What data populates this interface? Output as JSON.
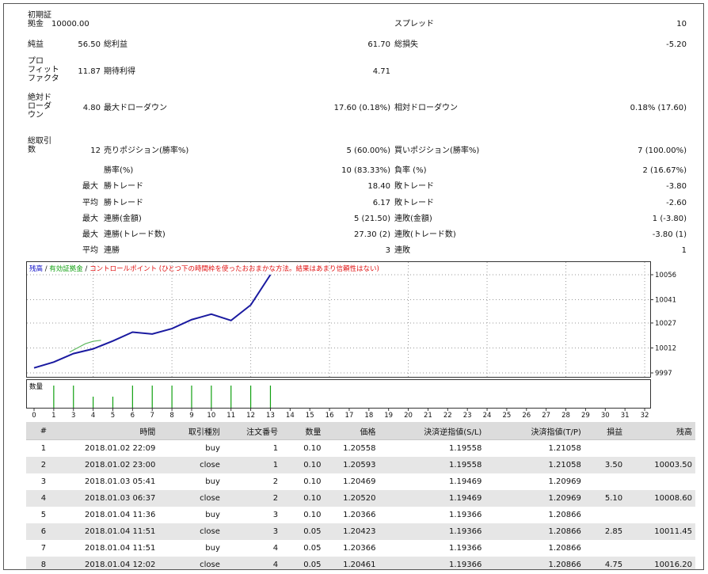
{
  "summary": {
    "initial_deposit_label": "初期証\n拠金",
    "initial_deposit": "10000.00",
    "spread_label": "スプレッド",
    "spread": "10",
    "net_profit_label": "純益",
    "net_profit": "56.50",
    "gross_profit_label": "総利益",
    "gross_profit": "61.70",
    "gross_loss_label": "総損失",
    "gross_loss": "-5.20",
    "profit_factor_label": "プロ\nフィット\nファクタ",
    "profit_factor": "11.87",
    "expected_payoff_label": "期待利得",
    "expected_payoff": "4.71",
    "abs_drawdown_label": "絶対ド\nローダ\nウン",
    "abs_drawdown": "4.80",
    "max_drawdown_label": "最大ドローダウン",
    "max_drawdown": "17.60 (0.18%)",
    "rel_drawdown_label": "相対ドローダウン",
    "rel_drawdown": "0.18% (17.60)",
    "total_trades_label": "総取引\n数",
    "total_trades": "12",
    "short_label": "売りポジション(勝率%)",
    "short_value": "5 (60.00%)",
    "long_label": "買いポジション(勝率%)",
    "long_value": "7 (100.00%)",
    "win_rate_label": "勝率(%)",
    "win_rate": "10 (83.33%)",
    "loss_rate_label": "負率 (%)",
    "loss_rate": "2 (16.67%)",
    "max_prefix": "最大",
    "avg_prefix": "平均",
    "largest_win_label": "勝トレード",
    "largest_win": "18.40",
    "largest_loss_label": "敗トレード",
    "largest_loss": "-3.80",
    "avg_win_label": "勝トレード",
    "avg_win": "6.17",
    "avg_loss_label": "敗トレード",
    "avg_loss": "-2.60",
    "max_consec_wins_label": "連勝(金額)",
    "max_consec_wins": "5 (21.50)",
    "max_consec_losses_label": "連敗(金額)",
    "max_consec_losses": "1 (-3.80)",
    "max_consec_profit_label": "連勝(トレード数)",
    "max_consec_profit": "27.30 (2)",
    "max_consec_loss_label": "連敗(トレード数)",
    "max_consec_loss": "-3.80 (1)",
    "avg_consec_wins_label": "連勝",
    "avg_consec_wins": "3",
    "avg_consec_losses_label": "連敗",
    "avg_consec_losses": "1"
  },
  "chart_data": {
    "type": "line",
    "legend": [
      {
        "text": "残高",
        "color": "#1010c8"
      },
      {
        "text": " / ",
        "color": "#111111"
      },
      {
        "text": "有効証拠金",
        "color": "#10a010"
      },
      {
        "text": " / ",
        "color": "#111111"
      },
      {
        "text": "コントロールポイント (ひとつ下の時間枠を使ったおおまかな方法。結果はあまり信頼性はない)",
        "color": "#e01010"
      }
    ],
    "y_ticks": [
      "10056",
      "10041",
      "10027",
      "10012",
      "9997"
    ],
    "ylim": [
      9997,
      10056
    ],
    "x_ticks": [
      "0",
      "1",
      "3",
      "4",
      "5",
      "6",
      "7",
      "8",
      "9",
      "10",
      "11",
      "12",
      "13",
      "14",
      "15",
      "16",
      "17",
      "18",
      "19",
      "20",
      "21",
      "22",
      "23",
      "24",
      "25",
      "26",
      "27",
      "28",
      "29",
      "30",
      "31",
      "32"
    ],
    "x_tick_pos": [
      0,
      1,
      2,
      3,
      4,
      5,
      6,
      7,
      8,
      9,
      10,
      11,
      12,
      13,
      14,
      15,
      16,
      17,
      18,
      19,
      20,
      21,
      22,
      23,
      24,
      25,
      26,
      27,
      28,
      29,
      30,
      31
    ],
    "balance": {
      "x": [
        0,
        1,
        2,
        3,
        4,
        5,
        6,
        7,
        8,
        9,
        10,
        11,
        12
      ],
      "y": [
        10000,
        10003.5,
        10008.6,
        10011.45,
        10016.2,
        10021.5,
        10020.4,
        10023.6,
        10029.0,
        10032.3,
        10028.5,
        10037.8,
        10056.0
      ]
    },
    "equity": {
      "x": [
        1.8,
        2.2,
        2.6,
        3.0,
        3.4
      ],
      "y": [
        10009.5,
        10012.0,
        10014.5,
        10016.0,
        10016.6
      ]
    },
    "volume_label": "数量",
    "volume": {
      "x": [
        1,
        2,
        3,
        4,
        5,
        6,
        7,
        8,
        9,
        10,
        11,
        12
      ],
      "values": [
        0.1,
        0.1,
        0.05,
        0.05,
        0.1,
        0.1,
        0.1,
        0.1,
        0.1,
        0.1,
        0.1,
        0.1
      ]
    }
  },
  "trades": {
    "headers": [
      "#",
      "時間",
      "取引種別",
      "注文番号",
      "数量",
      "価格",
      "決済逆指値(S/L)",
      "決済指値(T/P)",
      "損益",
      "残高"
    ],
    "rows": [
      [
        "1",
        "2018.01.02 22:09",
        "buy",
        "1",
        "0.10",
        "1.20558",
        "1.19558",
        "1.21058",
        "",
        ""
      ],
      [
        "2",
        "2018.01.02 23:00",
        "close",
        "1",
        "0.10",
        "1.20593",
        "1.19558",
        "1.21058",
        "3.50",
        "10003.50"
      ],
      [
        "3",
        "2018.01.03 05:41",
        "buy",
        "2",
        "0.10",
        "1.20469",
        "1.19469",
        "1.20969",
        "",
        ""
      ],
      [
        "4",
        "2018.01.03 06:37",
        "close",
        "2",
        "0.10",
        "1.20520",
        "1.19469",
        "1.20969",
        "5.10",
        "10008.60"
      ],
      [
        "5",
        "2018.01.04 11:36",
        "buy",
        "3",
        "0.10",
        "1.20366",
        "1.19366",
        "1.20866",
        "",
        ""
      ],
      [
        "6",
        "2018.01.04 11:51",
        "close",
        "3",
        "0.05",
        "1.20423",
        "1.19366",
        "1.20866",
        "2.85",
        "10011.45"
      ],
      [
        "7",
        "2018.01.04 11:51",
        "buy",
        "4",
        "0.05",
        "1.20366",
        "1.19366",
        "1.20866",
        "",
        ""
      ],
      [
        "8",
        "2018.01.04 12:02",
        "close",
        "4",
        "0.05",
        "1.20461",
        "1.19366",
        "1.20866",
        "4.75",
        "10016.20"
      ]
    ]
  }
}
